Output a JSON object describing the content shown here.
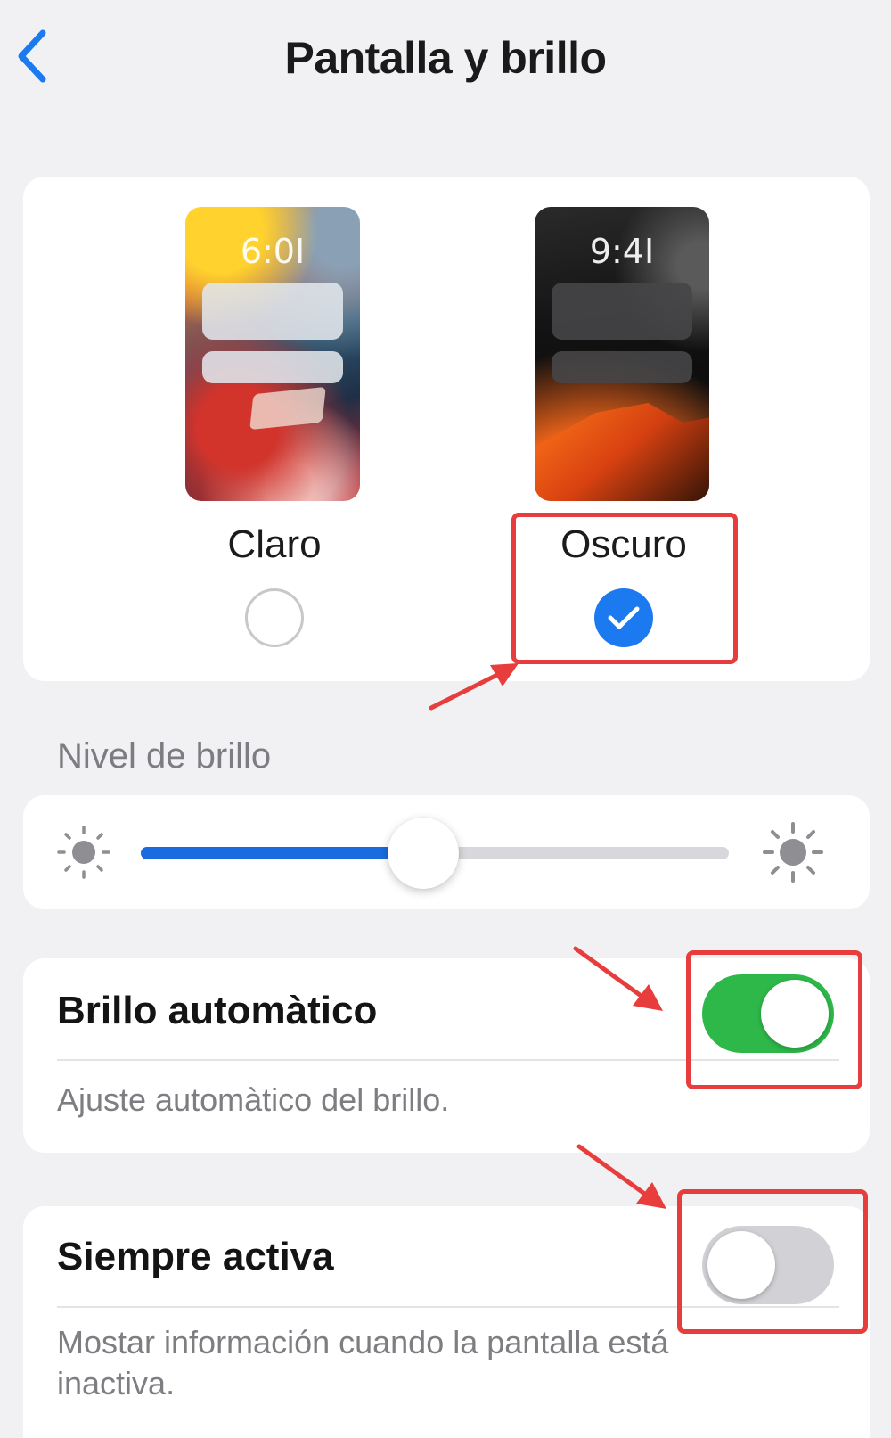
{
  "header": {
    "title": "Pantalla y brillo",
    "back_icon": "chevron-left-icon"
  },
  "appearance": {
    "options": [
      {
        "label": "Claro",
        "preview_time": "6:0I",
        "selected": false
      },
      {
        "label": "Oscuro",
        "preview_time": "9:4I",
        "selected": true
      }
    ],
    "selected_check_icon": "checkmark-icon"
  },
  "brightness": {
    "section_label": "Nivel de brillo",
    "level_fraction": 0.48,
    "min_icon": "sun-small-icon",
    "max_icon": "sun-large-icon"
  },
  "auto_brightness": {
    "title": "Brillo automàtico",
    "description": "Ajuste automàtico del brillo.",
    "enabled": true
  },
  "always_on": {
    "title": "Siempre activa",
    "description": "Mostar información cuando la pantalla está inactiva.",
    "enabled": false
  },
  "colors": {
    "accent_blue": "#1c7af0",
    "slider_blue": "#1a6bdf",
    "toggle_on": "#2fb84a",
    "toggle_off": "#d2d2d6",
    "annotation_red": "#e83d3d",
    "background": "#f1f1f3"
  }
}
